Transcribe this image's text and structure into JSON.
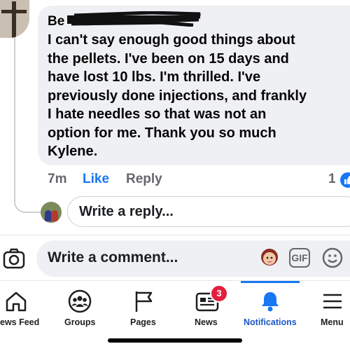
{
  "comment": {
    "author_visible": "Be",
    "text": "I can't say enough good things about\nthe pellets.  I've been on 15 days and\nhave lost 10 lbs. I'm thrilled.  I've\npreviously done injections, and frankly\nI hate needles so that was not an\noption for me.  Thank you so much\nKylene.",
    "time": "7m",
    "like_label": "Like",
    "reply_label": "Reply",
    "reaction_count": "1"
  },
  "reply_input": {
    "placeholder": "Write a reply..."
  },
  "comment_input": {
    "placeholder": "Write a comment...",
    "gif_label": "GIF"
  },
  "tabs": [
    {
      "label": "ews Feed",
      "icon": "home-icon"
    },
    {
      "label": "Groups",
      "icon": "groups-icon"
    },
    {
      "label": "Pages",
      "icon": "flag-icon"
    },
    {
      "label": "News",
      "icon": "news-icon",
      "badge": "3"
    },
    {
      "label": "Notifications",
      "icon": "bell-icon",
      "active": true
    },
    {
      "label": "Menu",
      "icon": "menu-icon"
    }
  ],
  "colors": {
    "accent": "#1877f2",
    "bubble": "#eff0f3",
    "badge": "#e41e3f",
    "secondary_text": "#65676b"
  }
}
